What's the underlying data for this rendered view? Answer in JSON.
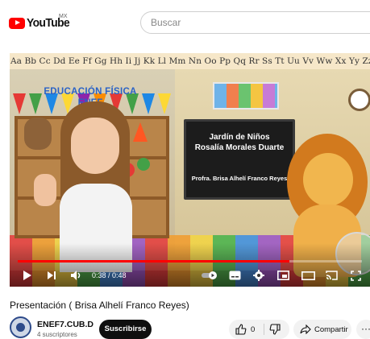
{
  "header": {
    "logo_text": "YouTube",
    "country_code": "MX",
    "search_placeholder": "Buscar"
  },
  "video": {
    "alphabet_strip": "Aa Bb Cc Dd Ee Ff Gg Hh Ii Jj Kk Ll Mm Nn Oo Pp Qq Rr Ss Tt Uu Vv Ww Xx Yy Zz",
    "banner_title": "EDUCACIÓN FÍSICA",
    "banner_subtitle": "ENEF",
    "screen_line1": "Jardín de Niños",
    "screen_line2": "Rosalía Morales Duarte",
    "screen_line3": "Profra. Brisa Alhelí Franco Reyes",
    "progress_fraction": 0.79
  },
  "controls": {
    "time_display": "0:38 / 0:48",
    "icons": [
      "play-icon",
      "next-icon",
      "volume-icon",
      "autoplay-toggle-icon",
      "subtitles-icon",
      "settings-icon",
      "miniplayer-icon",
      "theater-icon",
      "cast-icon",
      "fullscreen-icon"
    ]
  },
  "details": {
    "title": "Presentación ( Brisa Alhelí Franco Reyes)",
    "channel_name": "ENEF7.CUB.D",
    "subscribers": "4 suscriptores",
    "subscribe_label": "Suscribirse",
    "like_count": "0",
    "share_label": "Compartir",
    "more_label": "···"
  },
  "colors": {
    "brand_red": "#ff0000",
    "subscribe_bg": "#0f0f0f",
    "pill_bg": "#f2f2f2"
  }
}
